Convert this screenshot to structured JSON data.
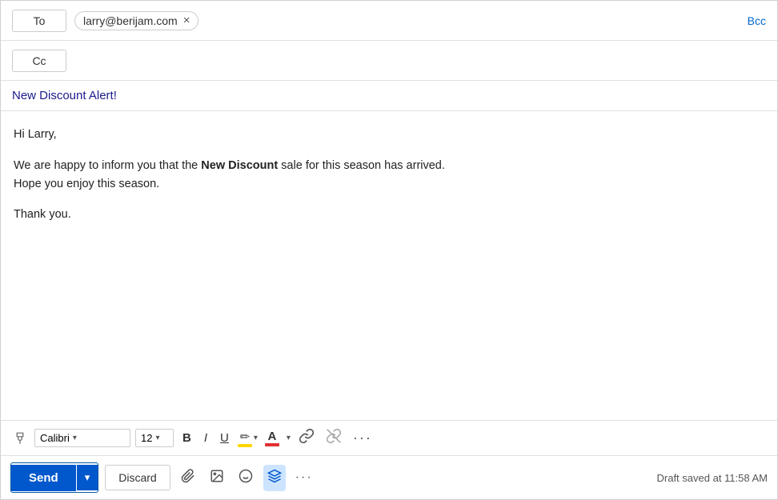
{
  "header": {
    "to_label": "To",
    "cc_label": "Cc",
    "bcc_label": "Bcc",
    "recipient": "larry@berijam.com",
    "subject": "New Discount Alert!"
  },
  "body": {
    "greeting": "Hi Larry,",
    "paragraph1_pre": "We are happy to inform you that the ",
    "paragraph1_bold": "New Discount",
    "paragraph1_post": " sale for this season has arrived.",
    "paragraph2": "Hope you enjoy this season.",
    "closing": "Thank you."
  },
  "toolbar": {
    "font_name": "Calibri",
    "font_size": "12",
    "bold_label": "B",
    "italic_label": "I",
    "underline_label": "U",
    "more_label": "···"
  },
  "actions": {
    "send_label": "Send",
    "discard_label": "Discard",
    "draft_status": "Draft saved at 11:58 AM",
    "more_label": "···"
  }
}
